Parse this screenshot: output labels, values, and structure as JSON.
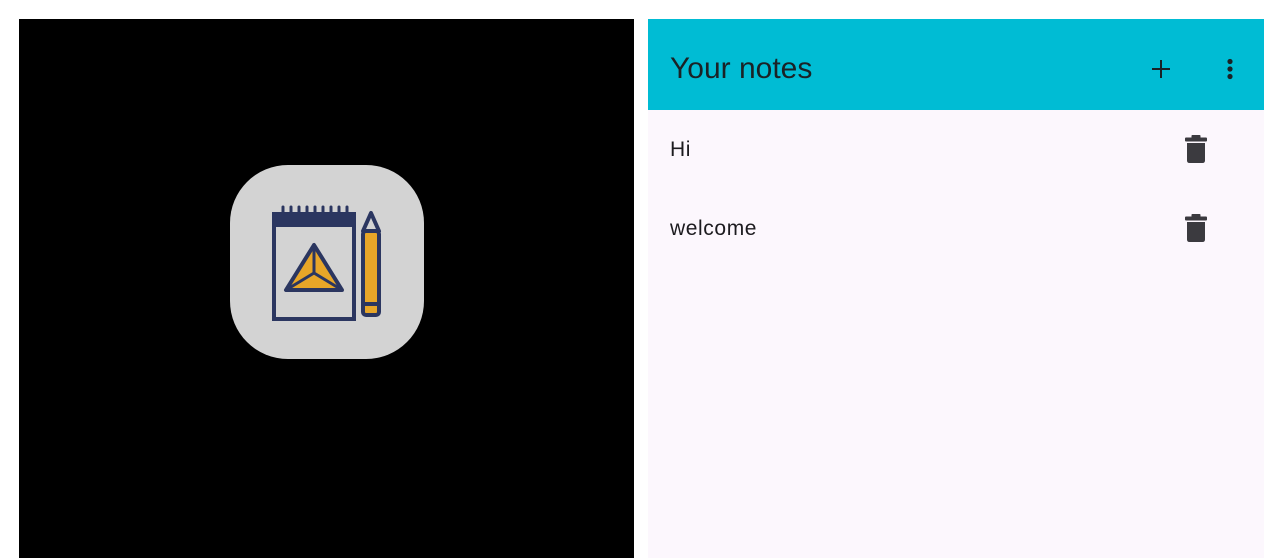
{
  "splash": {
    "icon_name": "notebook-pencil-icon",
    "icon_colors": {
      "tile": "#d3d3d3",
      "outline": "#2b3660",
      "accent": "#e8a628"
    }
  },
  "app_bar": {
    "title": "Your notes",
    "background": "#00bcd4",
    "actions": [
      {
        "name": "add-icon"
      },
      {
        "name": "more-vert-icon"
      }
    ]
  },
  "notes": [
    {
      "title": "Hi",
      "action_icon": "delete-icon"
    },
    {
      "title": "welcome",
      "action_icon": "delete-icon"
    }
  ]
}
